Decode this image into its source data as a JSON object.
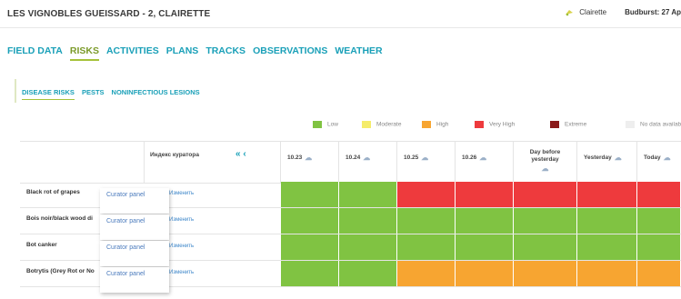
{
  "header": {
    "title": "LES VIGNOBLES GUEISSARD - 2, CLAIRETTE",
    "variety": "Clairette",
    "budburst": "Budburst: 27 Ap"
  },
  "main_tabs": [
    "FIELD DATA",
    "RISKS",
    "ACTIVITIES",
    "PLANS",
    "TRACKS",
    "OBSERVATIONS",
    "WEATHER"
  ],
  "main_tab_active": "RISKS",
  "sub_tabs": [
    "DISEASE RISKS",
    "PESTS",
    "NONINFECTIOUS LESIONS"
  ],
  "sub_tab_active": "DISEASE RISKS",
  "legend": [
    {
      "label": "Low",
      "color": "#80c342"
    },
    {
      "label": "Moderate",
      "color": "#f5ec6a"
    },
    {
      "label": "High",
      "color": "#f7a531"
    },
    {
      "label": "Very High",
      "color": "#ee3a3d"
    },
    {
      "label": "Extreme",
      "color": "#8b1a1a"
    },
    {
      "label": "No data availab",
      "color": "#eeeeee"
    }
  ],
  "table": {
    "curator_header": "Индекс куратора",
    "collapse_icon": "«  ‹",
    "columns": [
      "10.23",
      "10.24",
      "10.25",
      "10.26",
      "Day before yesterday",
      "Yesterday",
      "Today"
    ],
    "edit_label": "Изменить",
    "curator_panel_label": "Curator panel",
    "rows": [
      {
        "name": "Black rot of grapes",
        "risks": [
          "Low",
          "Low",
          "Very High",
          "Very High",
          "Very High",
          "Very High",
          "Very High"
        ]
      },
      {
        "name": "Bois noir/black wood di",
        "risks": [
          "Low",
          "Low",
          "Low",
          "Low",
          "Low",
          "Low",
          "Low"
        ]
      },
      {
        "name": "Bot canker",
        "risks": [
          "Low",
          "Low",
          "Low",
          "Low",
          "Low",
          "Low",
          "Low"
        ]
      },
      {
        "name": "Botrytis (Grey Rot or No",
        "risks": [
          "Low",
          "Low",
          "High",
          "High",
          "High",
          "High",
          "High"
        ]
      }
    ]
  },
  "icons": {
    "variety_icon": "grape-leaf-icon",
    "weather_icon": "partly-cloudy-rain-icon",
    "collapse": "double-chevron-left-icon"
  }
}
